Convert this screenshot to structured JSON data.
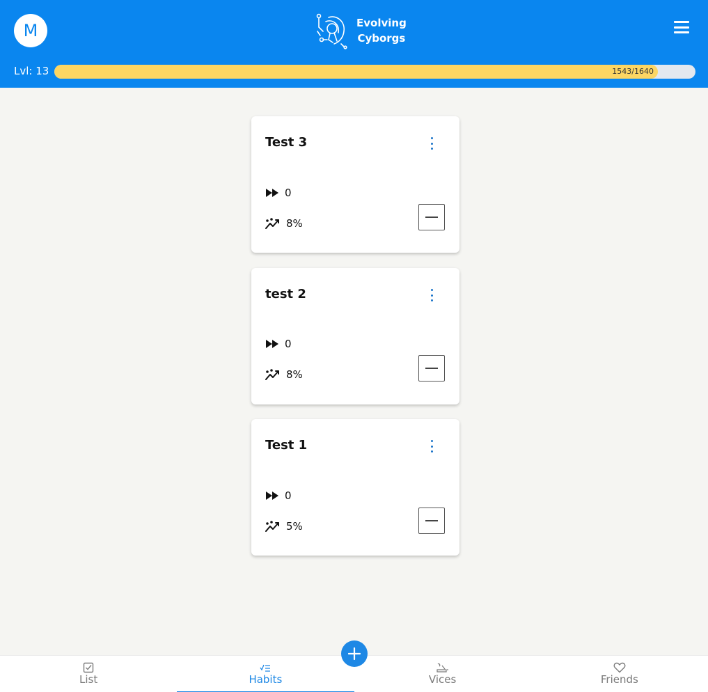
{
  "header": {
    "avatar_initial": "M",
    "app_name_line1": "Evolving",
    "app_name_line2": "Cyborgs",
    "menu_icon": "hamburger-icon",
    "level_label": "Lvl: 13",
    "xp_text": "1543/1640",
    "xp_progress_fraction": 0.941,
    "colors": {
      "header_bg": "#0a86ef",
      "xp_fill": "#fdd663",
      "xp_track": "#e3e8ef"
    }
  },
  "habits": [
    {
      "title": "Test 3",
      "streak": "0",
      "success_rate": "8%"
    },
    {
      "title": "test 2",
      "streak": "0",
      "success_rate": "8%"
    },
    {
      "title": "Test 1",
      "streak": "0",
      "success_rate": "5%"
    }
  ],
  "icons": {
    "streak": "fast-forward-icon",
    "rate": "trend-line-icon",
    "options": "vertical-dots-icon",
    "decrement": "minus-icon",
    "add": "plus-icon"
  },
  "fab": {
    "label": "+"
  },
  "bottom_nav": [
    {
      "label": "List",
      "icon": "checkbox-icon",
      "active": false
    },
    {
      "label": "Habits",
      "icon": "checklist-icon",
      "active": true
    },
    {
      "label": "Vices",
      "icon": "vices-icon",
      "active": false
    },
    {
      "label": "Friends",
      "icon": "heart-icon",
      "active": false
    }
  ],
  "accent_color": "#1e88e5"
}
